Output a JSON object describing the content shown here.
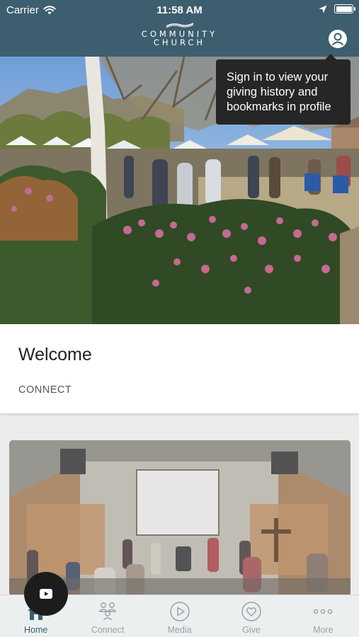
{
  "status_bar": {
    "carrier": "Carrier",
    "time": "11:58 AM"
  },
  "header": {
    "logo_line1": "COMMUNITY",
    "logo_line2": "CHURCH",
    "color": "#3d5e6e",
    "profile_icon": "user-circle-icon"
  },
  "tooltip": {
    "text": "Sign in to view your giving history and bookmarks in profile"
  },
  "welcome": {
    "title": "Welcome",
    "link": "CONNECT"
  },
  "media": {
    "play_icon": "play-icon"
  },
  "tabs": [
    {
      "label": "Home",
      "icon": "home-icon",
      "active": true
    },
    {
      "label": "Connect",
      "icon": "people-icon",
      "active": false
    },
    {
      "label": "Media",
      "icon": "play-circle-icon",
      "active": false
    },
    {
      "label": "Give",
      "icon": "heart-circle-icon",
      "active": false
    },
    {
      "label": "More",
      "icon": "more-dots-icon",
      "active": false
    }
  ]
}
